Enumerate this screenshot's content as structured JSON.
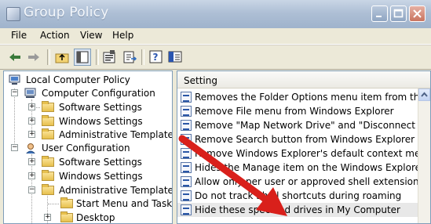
{
  "window": {
    "title": "Group Policy"
  },
  "menu": {
    "items": [
      "File",
      "Action",
      "View",
      "Help"
    ]
  },
  "toolbar": {
    "buttons": [
      "back-icon",
      "forward-icon",
      "up-folder-icon",
      "show-hide-tree-icon",
      "properties-icon",
      "export-icon",
      "help-icon",
      "extended-view-icon"
    ]
  },
  "tree": {
    "root": "Local Computer Policy",
    "computer_config": "Computer Configuration",
    "cc_software": "Software Settings",
    "cc_windows": "Windows Settings",
    "cc_admin": "Administrative Templates",
    "user_config": "User Configuration",
    "uc_software": "Software Settings",
    "uc_windows": "Windows Settings",
    "uc_admin": "Administrative Templates",
    "start_menu": "Start Menu and Taskba",
    "desktop": "Desktop"
  },
  "list": {
    "header": "Setting",
    "rows": [
      "Removes the Folder Options menu item from the Too",
      "Remove File menu from Windows Explorer",
      "Remove \"Map Network Drive\" and \"Disconnect Netwo",
      "Remove Search button from Windows Explorer",
      "Remove Windows Explorer's default context menu",
      "Hides the Manage item on the Windows Explorer con",
      "Allow only per user or approved shell extensions",
      "Do not track Shell shortcuts during roaming",
      "Hide these specified drives in My Computer"
    ]
  },
  "colors": {
    "arrow": "#d9201b",
    "highlight_row": "#e8e8e8"
  }
}
